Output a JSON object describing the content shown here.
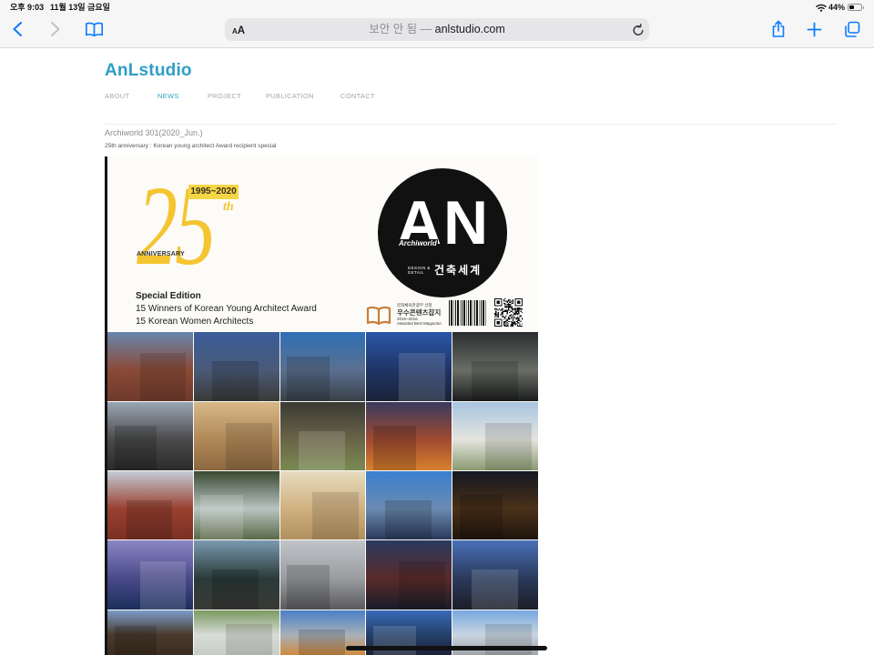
{
  "status_bar": {
    "time": "오후 9:03",
    "date": "11월 13일 금요일",
    "battery_label": "44%",
    "battery_level": 0.44
  },
  "toolbar": {
    "text_size_small": "A",
    "text_size_large": "A",
    "security_label": "보안 안 됨",
    "separator": "—",
    "domain": "anlstudio.com",
    "icons": {
      "back": "chevron-left-icon",
      "forward": "chevron-right-icon",
      "bookmarks": "book-icon",
      "reload": "reload-icon",
      "share": "share-icon",
      "new_tab": "plus-icon",
      "tabs": "tabs-icon",
      "wifi": "wifi-icon",
      "battery": "battery-icon"
    }
  },
  "colors": {
    "ios_blue": "#0a7aff",
    "brand": "#2e9fc7",
    "nav_inactive": "#a6a6a6",
    "cover_yellow": "#f4c531"
  },
  "site": {
    "logo": "AnLstudio",
    "nav": [
      {
        "label": "ABOUT",
        "active": false
      },
      {
        "label": "NEWS",
        "active": true
      },
      {
        "label": "PROJECT",
        "active": false
      },
      {
        "label": "PUBLICATION",
        "active": false
      },
      {
        "label": "CONTACT",
        "active": false
      }
    ]
  },
  "post": {
    "title": "Archiworld 301(2020_Jun.)",
    "subtitle": "25th anniversary : Korean young architect Award recipient special"
  },
  "cover": {
    "year_range": "1995~2020",
    "anniversary_number": "25",
    "anniversary_suffix": "th",
    "anniversary_label": "ANNIVERSARY",
    "edition": "Special Edition",
    "headline_1": "15 Winners of Korean Young Architect Award",
    "headline_2": "15 Korean Women Architects",
    "masthead": "AN",
    "masthead_sub": "Archiworld",
    "masthead_tag_1": "DESIGN &",
    "masthead_tag_2": "DETAIL",
    "masthead_korean": "건축세계",
    "award_line_1": "문화체육관광부 선정",
    "award_line_2": "우수콘텐츠잡지",
    "award_line_3": "2015~2016",
    "award_line_4": "Awarded Best Magazine",
    "photo_colors": [
      [
        "#6a86ad",
        "#8a4a36",
        "#6e3a2c"
      ],
      [
        "#3a5d9a",
        "#4a5a78",
        "#3a3a36"
      ],
      [
        "#2f6fb6",
        "#5a7090",
        "#3a4048"
      ],
      [
        "#2a56a8",
        "#1f3566",
        "#1a2238"
      ],
      [
        "#2a2e30",
        "#6a6e66",
        "#1c1e1e"
      ],
      [
        "#9aa6b4",
        "#4a4a4a",
        "#2a2a2a"
      ],
      [
        "#d8b888",
        "#b08858",
        "#8c6840"
      ],
      [
        "#3a3a34",
        "#6a6448",
        "#7a8a52"
      ],
      [
        "#3a3a60",
        "#a04a30",
        "#d8802e"
      ],
      [
        "#a8c4e0",
        "#e4e4de",
        "#8a9a70"
      ],
      [
        "#c4ccd6",
        "#9a4030",
        "#7a3024"
      ],
      [
        "#3a4a32",
        "#b8c4c0",
        "#5a6848"
      ],
      [
        "#e6dcc0",
        "#d0b080",
        "#b0905e"
      ],
      [
        "#3a80d0",
        "#6a8ab0",
        "#2a3a5a"
      ],
      [
        "#141822",
        "#4a3018",
        "#20160e"
      ],
      [
        "#8a86c4",
        "#4a4a8a",
        "#1a2e5a"
      ],
      [
        "#7a9ab0",
        "#2a3a38",
        "#3a3a36"
      ],
      [
        "#c0c4c8",
        "#9a9ca0",
        "#5a5a5c"
      ],
      [
        "#2a3a60",
        "#5a2a2a",
        "#181c2a"
      ],
      [
        "#4a70b8",
        "#2a3a5a",
        "#1a1e28"
      ],
      [
        "#7a9cc8",
        "#4a3a2c",
        "#3a2c20"
      ],
      [
        "#7a9a60",
        "#d8dcd8",
        "#c8ccc8"
      ],
      [
        "#4a80c8",
        "#a8b0b8",
        "#d08a40"
      ],
      [
        "#3a6ab8",
        "#24406a",
        "#1a2238"
      ],
      [
        "#78a8e0",
        "#c8d4e0",
        "#a0a4a8"
      ]
    ]
  }
}
